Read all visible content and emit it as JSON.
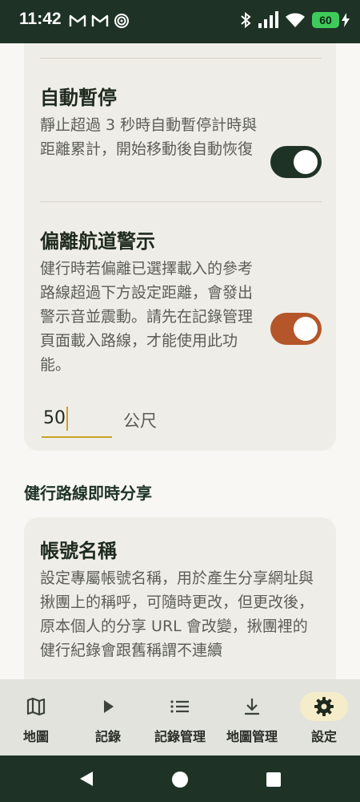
{
  "status_bar": {
    "time": "11:42",
    "left_icons": [
      "gmail-icon",
      "gmail-icon",
      "signal-app-icon"
    ],
    "right_icons": [
      "bluetooth-icon",
      "cell-signal-icon",
      "wifi-icon"
    ],
    "battery_level": "60",
    "charging": true
  },
  "settings": {
    "auto_pause": {
      "title": "自動暫停",
      "description": "靜止超過 3 秒時自動暫停計時與距離累計，開始移動後自動恢復",
      "enabled": true,
      "toggle_color": "#1e3326"
    },
    "off_route_alert": {
      "title": "偏離航道警示",
      "description": "健行時若偏離已選擇載入的參考路線超過下方設定距離，會發出警示音並震動。請先在記錄管理頁面載入路線，才能使用此功能。",
      "enabled": true,
      "toggle_color": "#b4562a",
      "distance_value": "50",
      "distance_unit": "公尺"
    },
    "sharing_section": {
      "heading": "健行路線即時分享",
      "account_name": {
        "title": "帳號名稱",
        "description": "設定專屬帳號名稱，用於產生分享網址與揪團上的稱呼，可隨時更改，但更改後，原本個人的分享 URL 會改變，揪團裡的健行紀錄會跟舊稱謂不連續"
      }
    }
  },
  "bottom_nav": {
    "items": [
      {
        "label": "地圖",
        "icon": "map-icon",
        "active": false
      },
      {
        "label": "記錄",
        "icon": "play-icon",
        "active": false
      },
      {
        "label": "記錄管理",
        "icon": "list-icon",
        "active": false
      },
      {
        "label": "地圖管理",
        "icon": "download-icon",
        "active": false
      },
      {
        "label": "設定",
        "icon": "gear-icon",
        "active": true
      }
    ]
  },
  "system_nav": [
    "back-icon",
    "home-icon",
    "recents-icon"
  ]
}
